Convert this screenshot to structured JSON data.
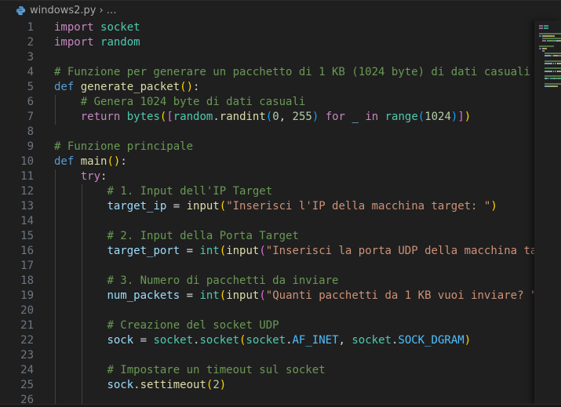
{
  "breadcrumb": {
    "file": "windows2.py",
    "separator": "›",
    "more": "…",
    "file_icon": "python-icon"
  },
  "colors": {
    "background": "#1f1f1f",
    "keyword": "#c586c0",
    "comment": "#6a9955",
    "string": "#ce9178",
    "function": "#dcdcaa",
    "class": "#4ec9b0"
  },
  "lines": [
    [
      [
        "kw",
        "import"
      ],
      [
        "p",
        " "
      ],
      [
        "cls",
        "socket"
      ]
    ],
    [
      [
        "kw",
        "import"
      ],
      [
        "p",
        " "
      ],
      [
        "cls",
        "random"
      ]
    ],
    [],
    [
      [
        "cm",
        "# Funzione per generare un pacchetto di 1 KB (1024 byte) di dati casuali"
      ]
    ],
    [
      [
        "def",
        "def"
      ],
      [
        "p",
        " "
      ],
      [
        "fn",
        "generate_packet"
      ],
      [
        "b1",
        "()"
      ],
      [
        "p",
        ":"
      ]
    ],
    [
      [
        "p",
        "    "
      ],
      [
        "cm",
        "# Genera 1024 byte di dati casuali"
      ]
    ],
    [
      [
        "p",
        "    "
      ],
      [
        "kw",
        "return"
      ],
      [
        "p",
        " "
      ],
      [
        "cls",
        "bytes"
      ],
      [
        "b1",
        "("
      ],
      [
        "b2",
        "["
      ],
      [
        "cls",
        "random"
      ],
      [
        "p",
        "."
      ],
      [
        "fn",
        "randint"
      ],
      [
        "b3",
        "("
      ],
      [
        "num",
        "0"
      ],
      [
        "p",
        ", "
      ],
      [
        "num",
        "255"
      ],
      [
        "b3",
        ")"
      ],
      [
        "p",
        " "
      ],
      [
        "kw",
        "for"
      ],
      [
        "p",
        " "
      ],
      [
        "var",
        "_"
      ],
      [
        "p",
        " "
      ],
      [
        "kw",
        "in"
      ],
      [
        "p",
        " "
      ],
      [
        "cls",
        "range"
      ],
      [
        "b3",
        "("
      ],
      [
        "num",
        "1024"
      ],
      [
        "b3",
        ")"
      ],
      [
        "b2",
        "]"
      ],
      [
        "b1",
        ")"
      ]
    ],
    [],
    [
      [
        "cm",
        "# Funzione principale"
      ]
    ],
    [
      [
        "def",
        "def"
      ],
      [
        "p",
        " "
      ],
      [
        "fn",
        "main"
      ],
      [
        "b1",
        "()"
      ],
      [
        "p",
        ":"
      ]
    ],
    [
      [
        "p",
        "    "
      ],
      [
        "kw",
        "try"
      ],
      [
        "p",
        ":"
      ]
    ],
    [
      [
        "p",
        "        "
      ],
      [
        "cm",
        "# 1. Input dell'IP Target"
      ]
    ],
    [
      [
        "p",
        "        "
      ],
      [
        "var",
        "target_ip"
      ],
      [
        "p",
        " = "
      ],
      [
        "fn",
        "input"
      ],
      [
        "b1",
        "("
      ],
      [
        "str",
        "\"Inserisci l'IP della macchina target: \""
      ],
      [
        "b1",
        ")"
      ]
    ],
    [],
    [
      [
        "p",
        "        "
      ],
      [
        "cm",
        "# 2. Input della Porta Target"
      ]
    ],
    [
      [
        "p",
        "        "
      ],
      [
        "var",
        "target_port"
      ],
      [
        "p",
        " = "
      ],
      [
        "cls",
        "int"
      ],
      [
        "b1",
        "("
      ],
      [
        "fn",
        "input"
      ],
      [
        "b2",
        "("
      ],
      [
        "str",
        "\"Inserisci la porta UDP della macchina target: \""
      ],
      [
        "b2",
        ")"
      ],
      [
        "b1",
        ")"
      ]
    ],
    [],
    [
      [
        "p",
        "        "
      ],
      [
        "cm",
        "# 3. Numero di pacchetti da inviare"
      ]
    ],
    [
      [
        "p",
        "        "
      ],
      [
        "var",
        "num_packets"
      ],
      [
        "p",
        " = "
      ],
      [
        "cls",
        "int"
      ],
      [
        "b1",
        "("
      ],
      [
        "fn",
        "input"
      ],
      [
        "b2",
        "("
      ],
      [
        "str",
        "\"Quanti pacchetti da 1 KB vuoi inviare? \""
      ],
      [
        "b2",
        ")"
      ],
      [
        "b1",
        ")"
      ]
    ],
    [],
    [
      [
        "p",
        "        "
      ],
      [
        "cm",
        "# Creazione del socket UDP"
      ]
    ],
    [
      [
        "p",
        "        "
      ],
      [
        "var",
        "sock"
      ],
      [
        "p",
        " = "
      ],
      [
        "cls",
        "socket"
      ],
      [
        "p",
        "."
      ],
      [
        "cls",
        "socket"
      ],
      [
        "b1",
        "("
      ],
      [
        "cls",
        "socket"
      ],
      [
        "p",
        "."
      ],
      [
        "const",
        "AF_INET"
      ],
      [
        "p",
        ", "
      ],
      [
        "cls",
        "socket"
      ],
      [
        "p",
        "."
      ],
      [
        "const",
        "SOCK_DGRAM"
      ],
      [
        "b1",
        ")"
      ]
    ],
    [],
    [
      [
        "p",
        "        "
      ],
      [
        "cm",
        "# Impostare un timeout sul socket"
      ]
    ],
    [
      [
        "p",
        "        "
      ],
      [
        "var",
        "sock"
      ],
      [
        "p",
        "."
      ],
      [
        "fn",
        "settimeout"
      ],
      [
        "b1",
        "("
      ],
      [
        "num",
        "2"
      ],
      [
        "b1",
        ")"
      ]
    ],
    []
  ]
}
